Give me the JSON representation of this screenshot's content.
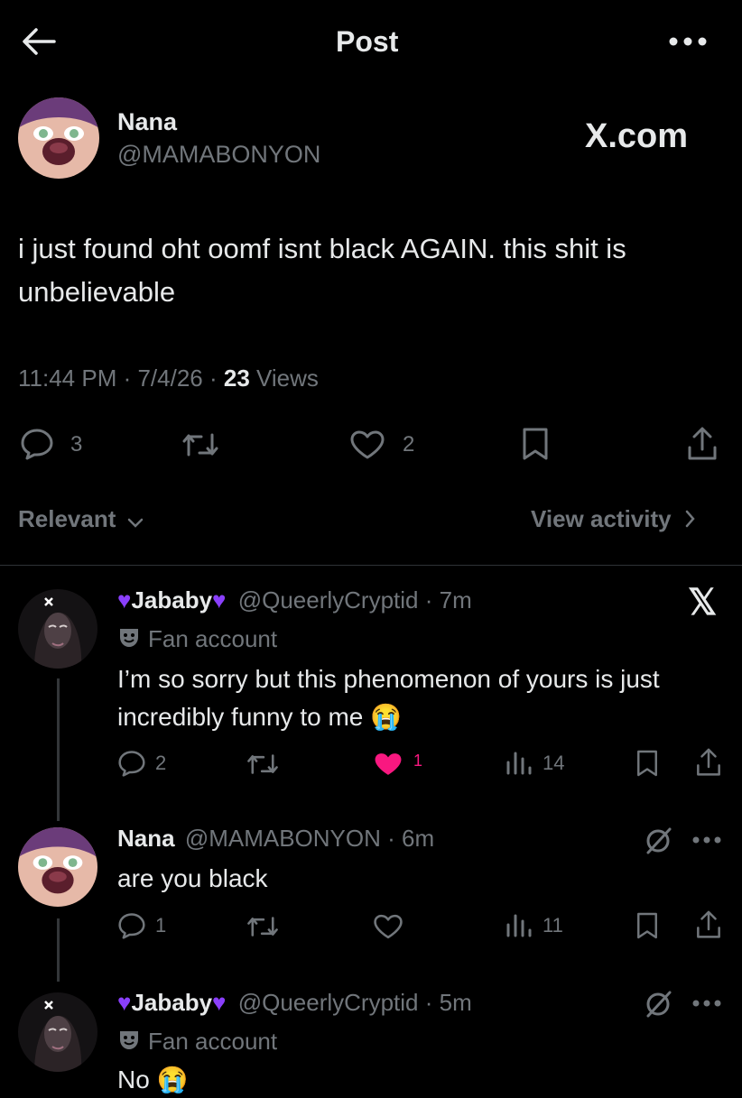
{
  "header": {
    "title": "Post"
  },
  "post": {
    "author_name": "Nana",
    "author_handle": "@MAMABONYON",
    "watermark": "X.com",
    "text": "i just found oht oomf isnt black AGAIN. this shit is unbelievable",
    "time": "11:44 PM",
    "date": "7/4/26",
    "views_count": "23",
    "views_label": "Views",
    "replies": "3",
    "likes": "2"
  },
  "sort": {
    "label": "Relevant",
    "view_activity": "View activity"
  },
  "replies": [
    {
      "name": "Jababy",
      "handle": "@QueerlyCryptid",
      "time": "7m",
      "badge": "Fan account",
      "text": "I’m so sorry but this phenomenon of yours is just incredibly funny to me 😭",
      "replies": "2",
      "likes": "1",
      "views": "14"
    },
    {
      "name": "Nana",
      "handle": "@MAMABONYON",
      "time": "6m",
      "text": "are you black",
      "replies": "1",
      "views": "11"
    },
    {
      "name": "Jababy",
      "handle": "@QueerlyCryptid",
      "time": "5m",
      "badge": "Fan account",
      "text": "No 😭"
    }
  ],
  "colors": {
    "like_active": "#f91880",
    "heart_emoji": "#8a3ffc",
    "muted": "#71767b"
  }
}
